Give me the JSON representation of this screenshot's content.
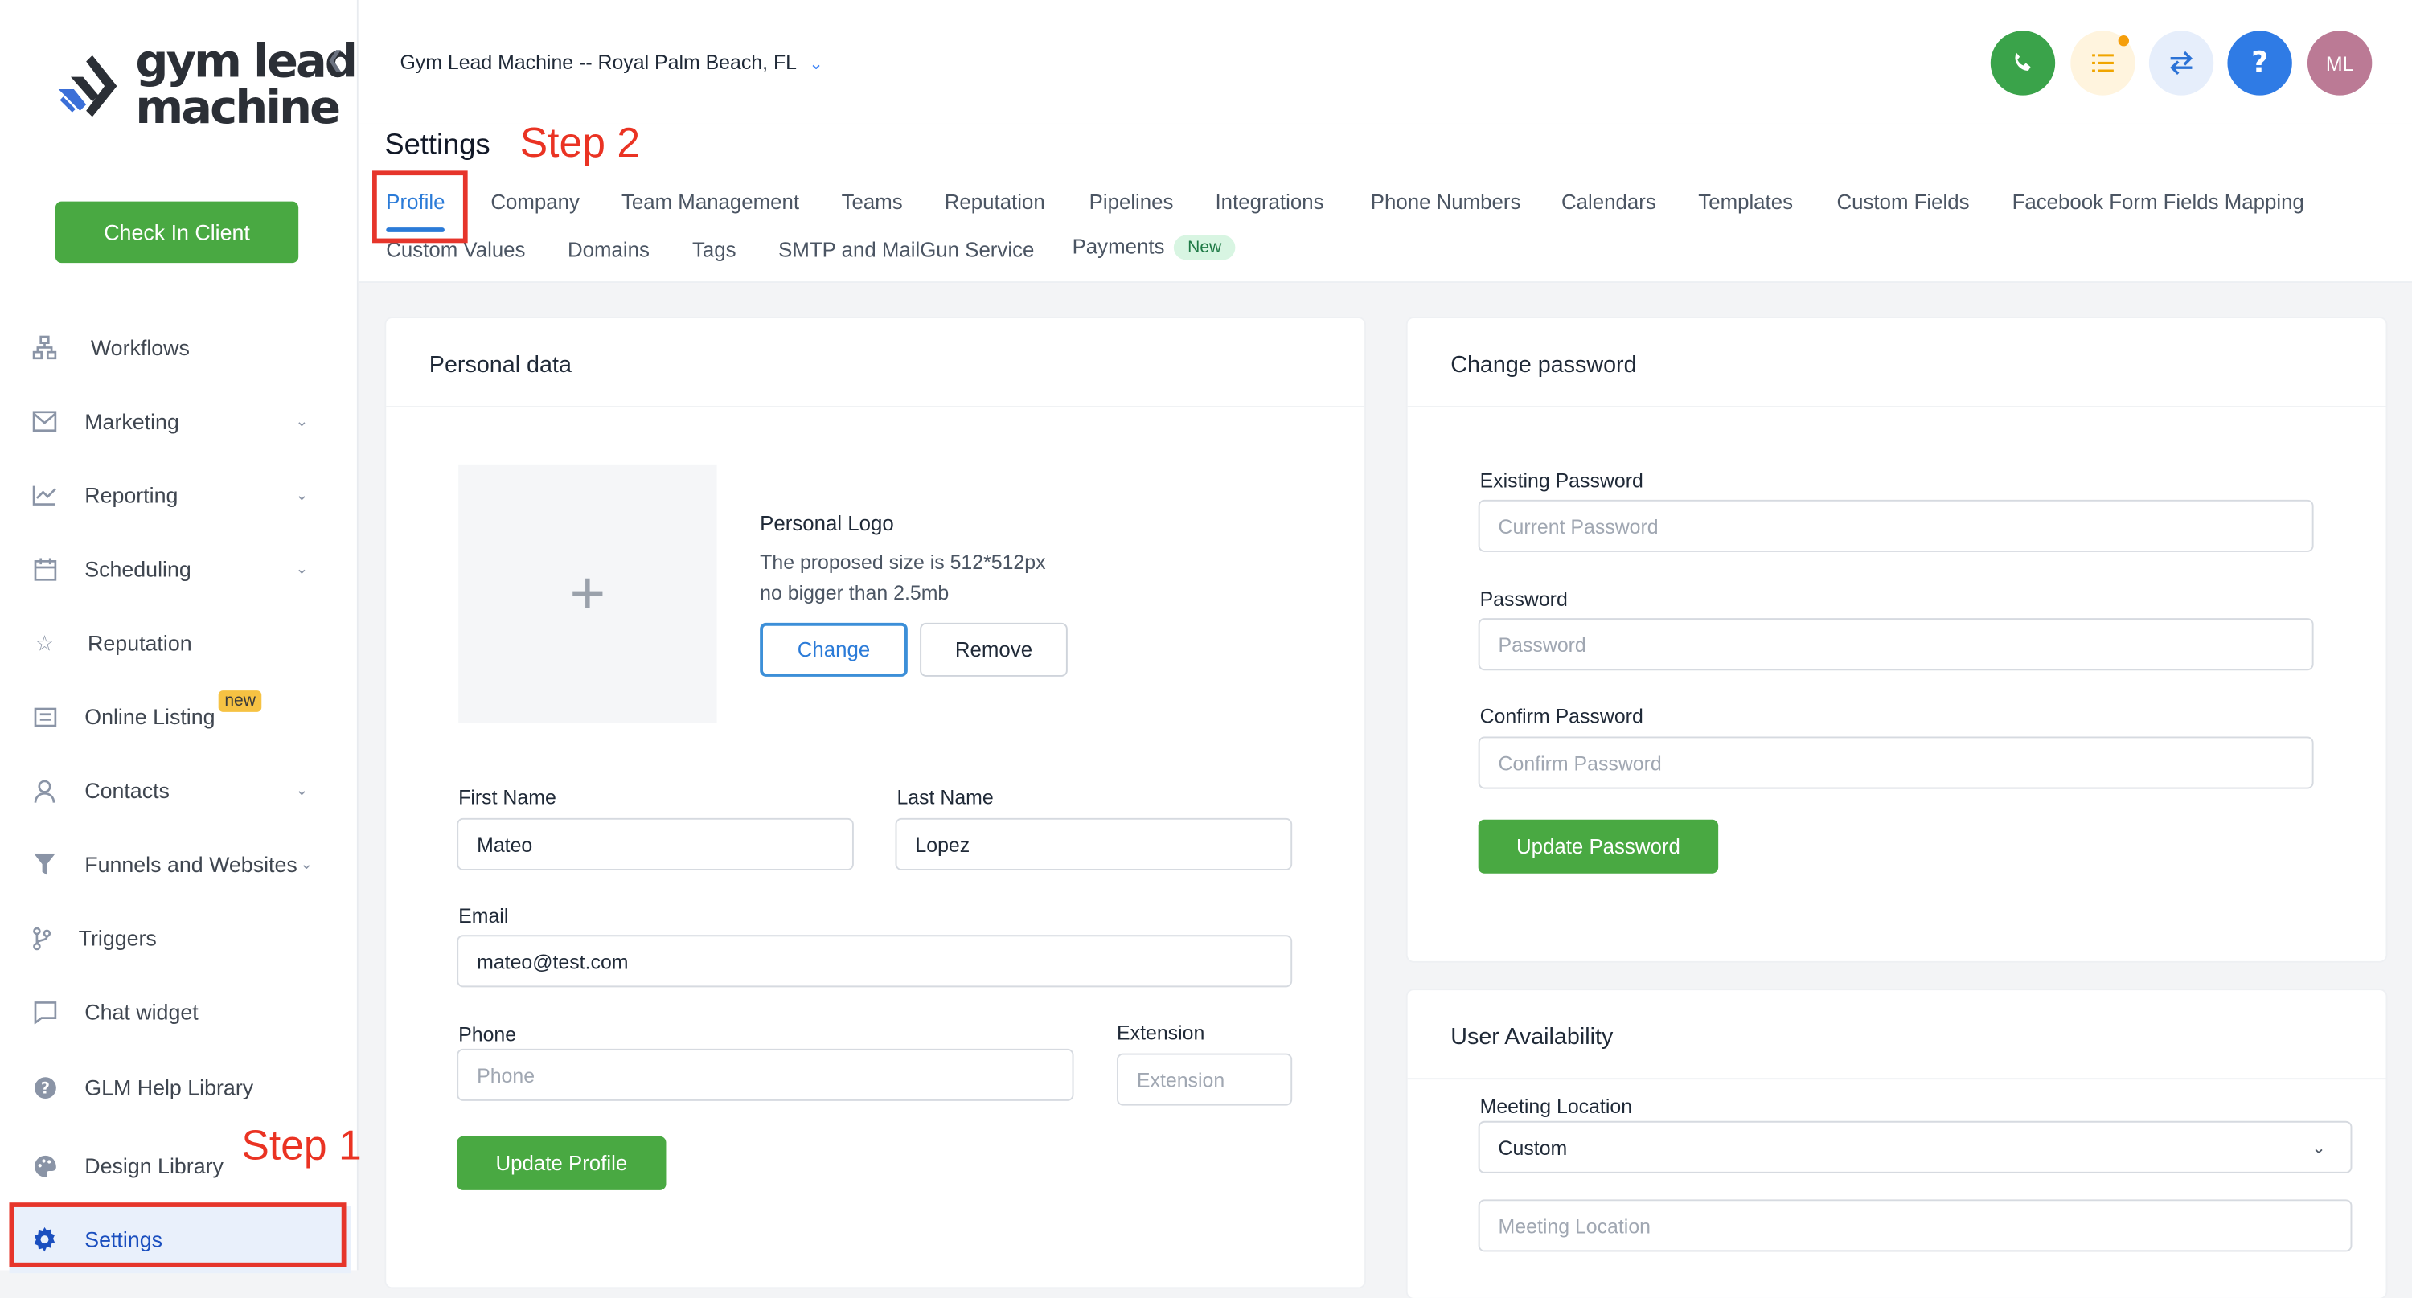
{
  "app": {
    "logo_line1": "gym lead",
    "logo_line2": "machine",
    "location": "Gym Lead Machine -- Royal Palm Beach, FL"
  },
  "sidebar": {
    "check_in_label": "Check In Client",
    "items": [
      {
        "label": "Workflows",
        "icon": "workflow-icon",
        "chevron": false
      },
      {
        "label": "Marketing",
        "icon": "mail-icon",
        "chevron": true
      },
      {
        "label": "Reporting",
        "icon": "chart-icon",
        "chevron": true
      },
      {
        "label": "Scheduling",
        "icon": "calendar-icon",
        "chevron": true
      },
      {
        "label": "Reputation",
        "icon": "star-icon",
        "chevron": false
      },
      {
        "label": "Online Listing",
        "icon": "list-icon",
        "chevron": false
      },
      {
        "label": "Contacts",
        "icon": "person-icon",
        "chevron": true
      },
      {
        "label": "Funnels and Websites",
        "icon": "funnel-icon",
        "chevron": true
      },
      {
        "label": "Triggers",
        "icon": "branch-icon",
        "chevron": false
      },
      {
        "label": "Chat widget",
        "icon": "chat-icon",
        "chevron": false
      },
      {
        "label": "GLM Help Library",
        "icon": "help-icon",
        "chevron": false
      },
      {
        "label": "Design Library",
        "icon": "palette-icon",
        "chevron": false
      },
      {
        "label": "Settings",
        "icon": "gear-icon",
        "chevron": false
      }
    ],
    "online_listing_badge": "new"
  },
  "annotations": {
    "step1": "Step 1",
    "step2": "Step 2",
    "color": "#ea3323"
  },
  "topbar": {
    "avatar_initials": "ML",
    "buttons": [
      "phone-icon",
      "tasks-icon",
      "switch-icon",
      "question-icon"
    ]
  },
  "settings": {
    "title": "Settings",
    "tabs_row1": [
      "Profile",
      "Company",
      "Team Management",
      "Teams",
      "Reputation",
      "Pipelines",
      "Integrations",
      "Phone Numbers",
      "Calendars",
      "Templates",
      "Custom Fields",
      "Facebook Form Fields Mapping"
    ],
    "tabs_row2": [
      "Custom Values",
      "Domains",
      "Tags",
      "SMTP and MailGun Service",
      "Payments"
    ],
    "payments_badge": "New",
    "active_tab": "Profile"
  },
  "personal": {
    "title": "Personal data",
    "logo_title": "Personal Logo",
    "logo_hint1": "The proposed size is 512*512px",
    "logo_hint2": "no bigger than 2.5mb",
    "change_label": "Change",
    "remove_label": "Remove",
    "first_name_label": "First Name",
    "first_name": "Mateo",
    "last_name_label": "Last Name",
    "last_name": "Lopez",
    "email_label": "Email",
    "email": "mateo@test.com",
    "phone_label": "Phone",
    "phone_placeholder": "Phone",
    "extension_label": "Extension",
    "extension_placeholder": "Extension",
    "update_label": "Update Profile"
  },
  "password": {
    "title": "Change password",
    "existing_label": "Existing Password",
    "existing_placeholder": "Current Password",
    "password_label": "Password",
    "password_placeholder": "Password",
    "confirm_label": "Confirm Password",
    "confirm_placeholder": "Confirm Password",
    "update_label": "Update Password"
  },
  "availability": {
    "title": "User Availability",
    "meeting_label": "Meeting Location",
    "meeting_value": "Custom",
    "meeting_placeholder": "Meeting Location"
  }
}
